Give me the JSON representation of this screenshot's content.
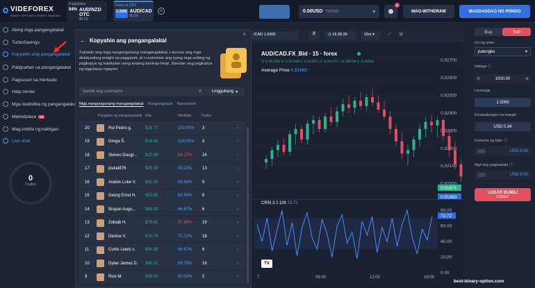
{
  "brand": {
    "name": "VIDEFOREX",
    "tagline": "BINARY OPTIONS & FOREX TRADING"
  },
  "assets": [
    {
      "category": "Pagpipilian",
      "payout": "84%",
      "name": "AUD/NZD OTC",
      "price": "$0.00"
    },
    {
      "category": "Forex at CFD",
      "payout": "1:2000",
      "name": "AUD/CAD",
      "price": "$0.00"
    }
  ],
  "header": {
    "balance": "0.00USD",
    "account": "TOTOO",
    "badge": "6",
    "withdraw": "MAG-WITHDRAW",
    "deposit": "MAGDAGDAG NG PONDO"
  },
  "nav": [
    {
      "label": "Aking mga pangangalakal"
    },
    {
      "label": "TurboSavings"
    },
    {
      "label": "Kopyahin ang pangangalakal"
    },
    {
      "label": "Paligsahan sa pangangalakal"
    },
    {
      "label": "Pagsusuri sa merkado"
    },
    {
      "label": "Help center"
    },
    {
      "label": "Mga istatistika ng pangangalakal"
    },
    {
      "label": "Marketplace",
      "badge": "15"
    },
    {
      "label": "Mag-imbita ng kaibigan"
    },
    {
      "label": "Live chat"
    }
  ],
  "trades_count": {
    "value": "0",
    "label": "Trades"
  },
  "panel": {
    "title": "Kopyahin ang pangangalakal",
    "description": "Tuklasin ang mga nangungunang mangangalakal, i-access ang mga detalyadong insight sa paggamit, at i-customize ang iyong mga setting ng pagkopya ng kalakalan nang walang kahirap-hirap. Simulan ang pagkopya ng tagumpay ngayon!",
    "search_placeholder": "Ipasok ang username",
    "period": "Lingguhang",
    "tabs": [
      "Mga nangungunang mangangalakal",
      "Nangongopya",
      "Nanonood"
    ],
    "columns": [
      "Pangalan ng mangangalakal",
      "Kita",
      "WinRate",
      "Trades"
    ],
    "rows": [
      {
        "rank": "20",
        "name": "Rui Pedro g.",
        "profit": "$16.77",
        "winrate": "100.00%",
        "trades": "3"
      },
      {
        "rank": "19",
        "name": "Grega Š.",
        "profit": "$18.96",
        "winrate": "100.00%",
        "trades": "3"
      },
      {
        "rank": "18",
        "name": "Steven Dougl...",
        "profit": "$22.99",
        "winrate": "54.17%",
        "trades": "24"
      },
      {
        "rank": "17",
        "name": "piskal876",
        "profit": "$39.38",
        "winrate": "69.23%",
        "trades": "13"
      },
      {
        "rank": "16",
        "name": "Avalon Luke V.",
        "profit": "$42.00",
        "winrate": "88.89%",
        "trades": "9"
      },
      {
        "rank": "15",
        "name": "Georg Ernst H.",
        "profit": "$53.82",
        "winrate": "62.50%",
        "trades": "8"
      },
      {
        "rank": "14",
        "name": "Brayan Augu...",
        "profit": "$68.08",
        "winrate": "66.67%",
        "trades": "6"
      },
      {
        "rank": "13",
        "name": "Zobaib H.",
        "profit": "$76.65",
        "winrate": "57.89%",
        "trades": "19"
      },
      {
        "rank": "12",
        "name": "Denise V.",
        "profit": "$76.76",
        "winrate": "72.22%",
        "trades": "18"
      },
      {
        "rank": "11",
        "name": "Curtis Lewis c.",
        "profit": "$84.88",
        "winrate": "66.67%",
        "trades": "6"
      },
      {
        "rank": "10",
        "name": "Dylan James D.",
        "profit": "$85.23",
        "winrate": "68.75%",
        "trades": "16"
      },
      {
        "rank": "9",
        "name": "Rick M.",
        "profit": "$96.50",
        "winrate": "80.00%",
        "trades": "5"
      }
    ]
  },
  "chart": {
    "pair_select": "/CAD 1:2000",
    "time": "16:28:39",
    "interval": "15m",
    "title": "AUD/CAD.FX_Bid · 15 · forex",
    "ohlc": "O 0.91936  H 0.91998  L 0.91971  C 0.91971 −0.00034 (−0.04%)",
    "avg_price_label": "Average Price",
    "avg_price": "0.91960",
    "price_ticks": [
      "0.92700",
      "0.92600",
      "0.92500",
      "0.92400",
      "0.92300",
      "0.92200",
      "0.92100",
      "0.92000"
    ],
    "last_price": "0.91971",
    "avg_tag": "0.91960",
    "indicator": "CRSI 3 2 100",
    "indicator_value": "72.72",
    "ind_ticks": [
      "80.00",
      "60.00",
      "40.00",
      "20.00",
      "0.00"
    ],
    "ind_tag": "72.72",
    "x_ticks": [
      "7",
      "06:00",
      "12:00",
      "18:00"
    ],
    "ohlc_series": [
      [
        0.9212,
        0.9216,
        0.9208,
        0.9214
      ],
      [
        0.9214,
        0.9221,
        0.921,
        0.9219
      ],
      [
        0.9219,
        0.9225,
        0.9215,
        0.9222
      ],
      [
        0.9222,
        0.9226,
        0.9216,
        0.9218
      ],
      [
        0.9218,
        0.923,
        0.9216,
        0.9228
      ],
      [
        0.9228,
        0.9234,
        0.9222,
        0.9231
      ],
      [
        0.9231,
        0.9233,
        0.9223,
        0.9225
      ],
      [
        0.9225,
        0.9236,
        0.9222,
        0.9234
      ],
      [
        0.9234,
        0.9239,
        0.9228,
        0.9236
      ],
      [
        0.9236,
        0.9238,
        0.9229,
        0.9231
      ],
      [
        0.9231,
        0.924,
        0.9229,
        0.9238
      ],
      [
        0.9238,
        0.9243,
        0.9233,
        0.9235
      ],
      [
        0.9235,
        0.9244,
        0.9232,
        0.9241
      ],
      [
        0.9241,
        0.9248,
        0.9238,
        0.9245
      ],
      [
        0.9245,
        0.925,
        0.924,
        0.9243
      ],
      [
        0.9243,
        0.9249,
        0.9239,
        0.9247
      ],
      [
        0.9247,
        0.9252,
        0.9242,
        0.9244
      ],
      [
        0.9244,
        0.9251,
        0.9241,
        0.9249
      ],
      [
        0.9249,
        0.9254,
        0.9244,
        0.9246
      ],
      [
        0.9246,
        0.925,
        0.924,
        0.9242
      ],
      [
        0.9242,
        0.9247,
        0.9236,
        0.9238
      ],
      [
        0.9238,
        0.9241,
        0.9228,
        0.9231
      ],
      [
        0.9231,
        0.9234,
        0.9221,
        0.9224
      ],
      [
        0.9224,
        0.9229,
        0.9214,
        0.9217
      ],
      [
        0.9217,
        0.9222,
        0.921,
        0.9219
      ],
      [
        0.9219,
        0.9227,
        0.9215,
        0.9225
      ],
      [
        0.9225,
        0.9234,
        0.9221,
        0.9231
      ],
      [
        0.9231,
        0.9238,
        0.9226,
        0.9235
      ],
      [
        0.9235,
        0.9239,
        0.9229,
        0.9233
      ],
      [
        0.9233,
        0.9238,
        0.9226,
        0.9236
      ],
      [
        0.9236,
        0.9237,
        0.9224,
        0.9227
      ],
      [
        0.9227,
        0.9231,
        0.9215,
        0.9219
      ],
      [
        0.9219,
        0.9224,
        0.9208,
        0.9211
      ],
      [
        0.9211,
        0.9214,
        0.9201,
        0.9204
      ],
      [
        0.9204,
        0.9207,
        0.9196,
        0.9198
      ],
      [
        0.9198,
        0.9202,
        0.9194,
        0.9197
      ]
    ],
    "crsi_series": [
      62,
      40,
      70,
      28,
      55,
      80,
      35,
      64,
      22,
      58,
      77,
      45,
      30,
      68,
      50,
      20,
      60,
      74,
      38,
      52,
      18,
      66,
      48,
      72,
      26,
      58,
      40,
      70,
      34,
      62,
      80,
      46,
      24,
      56,
      42,
      72
    ]
  },
  "trade_panel": {
    "buy": "Buy",
    "sell": "Sell",
    "order_type_label": "Uri ng order",
    "order_type": "palengke",
    "amount_label": "Halaga",
    "amount": "1000.00",
    "leverage_label": "Leverage",
    "leverage": "1:2000",
    "margin_label": "Kinakailangan sa margin",
    "margin": "USD 0.34",
    "tp_label": "Kumuha ng tubo",
    "tp": "USD 0.00",
    "sl_label": "Itigil ang pagkawala",
    "sl": "USD 0.00",
    "action": "LUGAR BUMILI",
    "action_price": "0.92007"
  },
  "watermark": "best-binary-option.com",
  "colors": {
    "accent": "#2f6fe0",
    "sell": "#e34f5e",
    "up": "#2bb38b",
    "down": "#e34f5e",
    "winrate_high": "#4aa3ff",
    "winrate_low": "#e34f5e"
  }
}
